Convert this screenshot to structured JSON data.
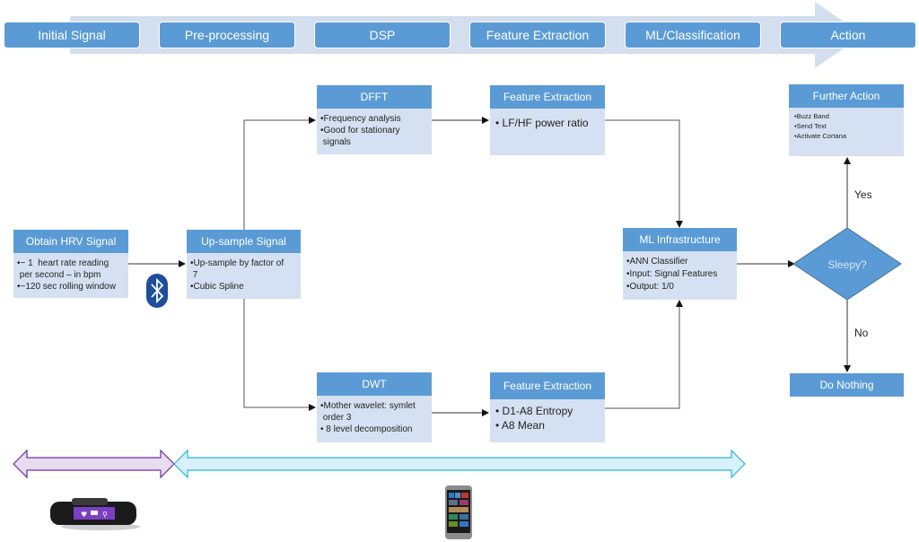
{
  "stages": [
    "Initial Signal",
    "Pre-processing",
    "DSP",
    "Feature Extraction",
    "ML/Classification",
    "Action"
  ],
  "boxes": {
    "obtain_hrv": {
      "title": "Obtain HRV Signal",
      "items": [
        "•~ 1  heart rate reading\n per second – in bpm",
        "•~120 sec rolling window"
      ]
    },
    "upsample": {
      "title": "Up-sample Signal",
      "items": [
        "•Up-sample by factor of\n 7",
        "•Cubic Spline"
      ]
    },
    "dfft": {
      "title": "DFFT",
      "items": [
        "•Frequency analysis",
        "•Good for stationary\n signals"
      ]
    },
    "fe_top": {
      "title": "Feature Extraction",
      "items": [
        "• LF/HF power ratio"
      ]
    },
    "dwt": {
      "title": "DWT",
      "items": [
        "•Mother wavelet: symlet\n order 3",
        "• 8 level decomposition"
      ]
    },
    "fe_bottom": {
      "title": "Feature Extraction",
      "items": [
        "• D1-A8 Entropy",
        "• A8 Mean"
      ]
    },
    "ml": {
      "title": "ML Infrastructure",
      "items": [
        "•ANN Classifier",
        "•Input: Signal Features",
        "•Output: 1/0"
      ]
    },
    "further": {
      "title": "Further Action",
      "items": [
        "•Buzz Band",
        "•Send Text",
        "•Activate Cortana"
      ]
    },
    "do_nothing": {
      "title": "Do Nothing"
    }
  },
  "decision": {
    "label": "Sleepy?",
    "yes": "Yes",
    "no": "No"
  },
  "icons": {
    "bluetooth": "bluetooth-icon",
    "band": "smart-band-image",
    "phone": "smartphone-image"
  },
  "colors": {
    "stage_fill": "#5b9bd5",
    "box_header": "#5b9bd5",
    "box_body": "#d5e1f2",
    "band_arrow": "#7030a0",
    "phone_arrow": "#2bb5d8",
    "bluetooth": "#1e4e9c"
  }
}
